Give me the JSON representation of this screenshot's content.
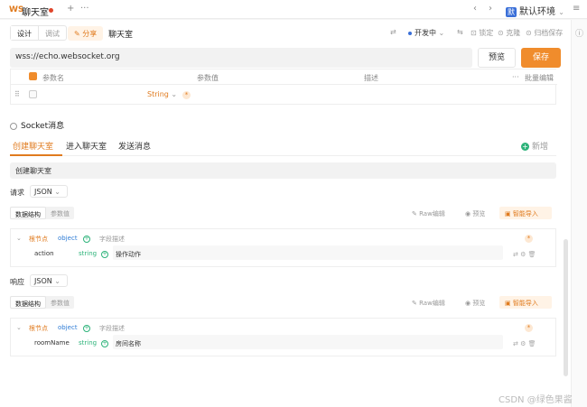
{
  "titlebar": {
    "ws_badge": "WS",
    "tab_title": "聊天室",
    "add_tab": "+",
    "more": "···",
    "env_badge": "默",
    "env_name": "默认环境",
    "nav_left": "‹",
    "nav_right": "›",
    "menu": "≡"
  },
  "toolbar": {
    "mode_design": "设计",
    "mode_debug": "调试",
    "share": "分享",
    "request_name": "聊天室",
    "env_status": "开发中",
    "lock": "锁定",
    "clone": "克隆",
    "archive": "归档保存"
  },
  "url": {
    "value": "wss://echo.websocket.org",
    "preview_label": "预览",
    "save_label": "保存"
  },
  "params": {
    "col_name": "参数名",
    "col_value": "参数值",
    "col_desc": "描述",
    "more": "···",
    "bulk_edit": "批量编辑",
    "type_value": "String"
  },
  "socket": {
    "section_title": "Socket消息",
    "tabs": [
      "创建聊天室",
      "进入聊天室",
      "发送消息"
    ],
    "add_new": "新增",
    "message_name": "创建聊天室"
  },
  "request": {
    "label": "请求",
    "format": "JSON",
    "subtab_structure": "数据结构",
    "subtab_values": "参数值",
    "raw_edit": "Raw编辑",
    "preview": "预览",
    "smart_import": "智能导入",
    "root_node": "根节点",
    "root_type": "object",
    "root_desc": "字段描述",
    "field_name": "action",
    "field_type": "string",
    "field_desc": "操作动作"
  },
  "response": {
    "label": "响应",
    "format": "JSON",
    "subtab_structure": "数据结构",
    "subtab_values": "参数值",
    "raw_edit": "Raw编辑",
    "preview": "预览",
    "smart_import": "智能导入",
    "root_node": "根节点",
    "root_type": "object",
    "root_desc": "字段描述",
    "field_name": "roomName",
    "field_type": "string",
    "field_desc": "房间名称"
  },
  "watermark": "CSDN @绿色果酱",
  "colors": {
    "accent": "#f08c2c",
    "env_blue": "#3a6fd8",
    "green": "#2db37a"
  }
}
